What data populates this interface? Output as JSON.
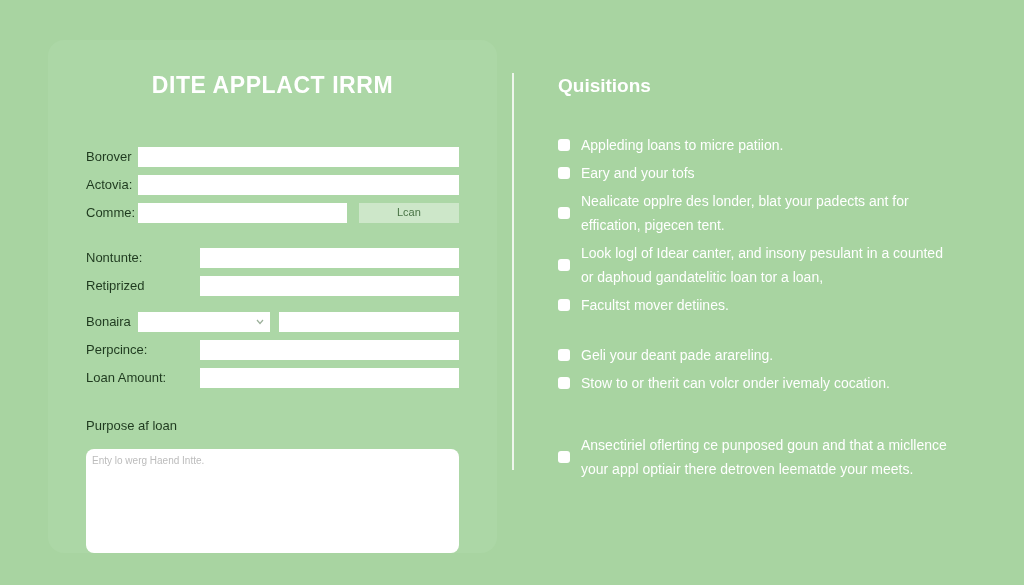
{
  "form": {
    "title": "DITE APPLACT IRRM",
    "groups": [
      {
        "kind": "short",
        "fields": [
          {
            "kind": "text",
            "label": "Borover"
          },
          {
            "kind": "text",
            "label": "Actovia:"
          },
          {
            "kind": "text_button",
            "label": "Comme:",
            "button": "Lcan"
          }
        ]
      },
      {
        "kind": "long",
        "fields": [
          {
            "kind": "text",
            "label": "Nontunte:"
          },
          {
            "kind": "text",
            "label": "Retiprized"
          }
        ]
      },
      {
        "kind": "mixed",
        "fields": [
          {
            "kind": "select_text",
            "label": "Bonaira"
          },
          {
            "kind": "text",
            "label": "Perpcince:"
          },
          {
            "kind": "text",
            "label": "Loan Amount:"
          }
        ]
      }
    ],
    "purpose": {
      "label": "Purpose af loan",
      "placeholder": "Enty lo werg Haend Intte."
    }
  },
  "questions": {
    "title": "Quisitions",
    "groups": [
      [
        {
          "text": "Appleding loans to micre patiion.",
          "checked": false
        },
        {
          "text": "Eary and your tofs",
          "checked": false
        },
        {
          "text": "Nealicate opplre des londer, blat your padects ant for effication, pigecen tent.",
          "checked": false
        },
        {
          "text": "Look logl of Idear canter, and insony pesulant in a counted or daphoud gandatelitic loan tor a loan,",
          "checked": false
        },
        {
          "text": "Facultst mover detiines.",
          "checked": false
        }
      ],
      [
        {
          "text": "Geli your deant pade arareling.",
          "checked": false
        },
        {
          "text": "Stow to or therit can volcr onder ivemaly cocation.",
          "checked": false
        }
      ],
      [
        {
          "text": "Ansectiriel oflerting ce punposed goun and that a micllence your appl optiair there detroven leematde your meets.",
          "checked": false
        }
      ]
    ]
  }
}
